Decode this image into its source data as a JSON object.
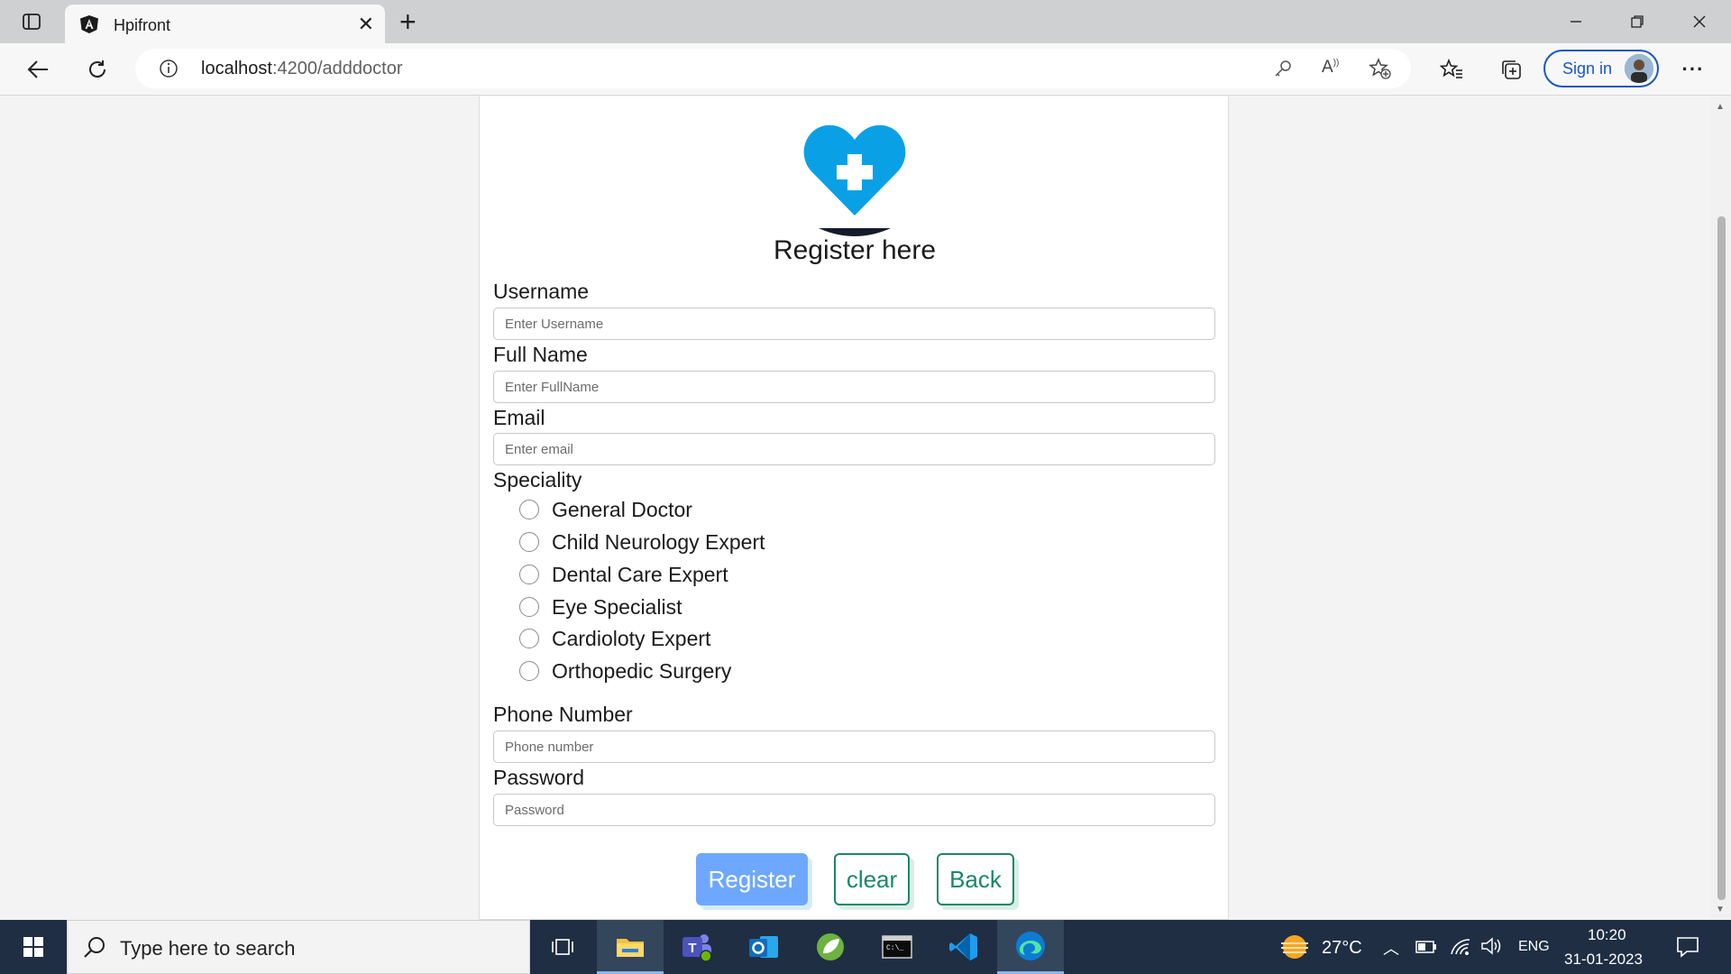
{
  "browser": {
    "tab_title": "Hpifront",
    "url_host": "localhost",
    "url_path": ":4200/adddoctor",
    "signin_label": "Sign in"
  },
  "form": {
    "heading": "Register here",
    "username": {
      "label": "Username",
      "placeholder": "Enter Username"
    },
    "fullname": {
      "label": "Full Name",
      "placeholder": "Enter FullName"
    },
    "email": {
      "label": "Email",
      "placeholder": "Enter email"
    },
    "speciality": {
      "label": "Speciality",
      "options": [
        "General Doctor",
        "Child Neurology Expert",
        "Dental Care Expert",
        "Eye Specialist",
        "Cardioloty Expert",
        "Orthopedic Surgery"
      ]
    },
    "phone": {
      "label": "Phone Number",
      "placeholder": "Phone number"
    },
    "password": {
      "label": "Password",
      "placeholder": "Password"
    },
    "buttons": {
      "register": "Register",
      "clear": "clear",
      "back": "Back"
    }
  },
  "taskbar": {
    "search_placeholder": "Type here to search",
    "weather": "27°C",
    "language": "ENG",
    "time": "10:20",
    "date": "31-01-2023"
  },
  "colors": {
    "accent_blue": "#6ea8fe",
    "outline_green": "#19876a",
    "logo_blue": "#0aa0e6"
  }
}
